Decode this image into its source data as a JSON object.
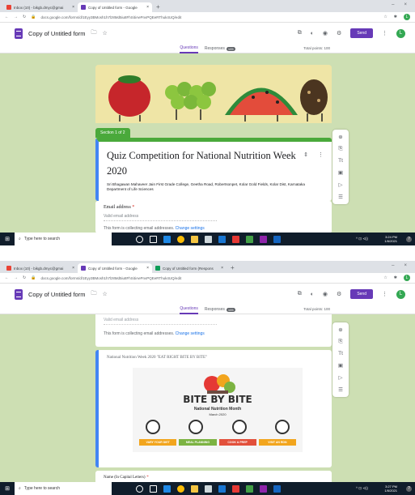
{
  "colors": {
    "accent": "#673ab7",
    "section": "#4aa93b",
    "canvas": "#cddfb3",
    "focus": "#4285f4"
  },
  "shot1": {
    "tabs": [
      {
        "label": "Inbox (10) - bikgb.dmyc@gmai",
        "fav": "#ea4335"
      },
      {
        "label": "Copy of Untitled form - Google",
        "fav": "#673ab7"
      }
    ],
    "url": "docs.google.com/forms/d/1Eyy3BMosh1h7lz8Md5iu8FhSitiAePnvPQEeRThuk4UQ/edit",
    "clock": {
      "time": "3:24 PM",
      "date": "1/6/2021"
    }
  },
  "shot2": {
    "tabs": [
      {
        "label": "Inbox (10) - bikgb.dmyc@gmai",
        "fav": "#ea4335"
      },
      {
        "label": "Copy of Untitled form - Google",
        "fav": "#673ab7"
      },
      {
        "label": "Copy of Untitled form (Respons",
        "fav": "#0f9d58"
      }
    ],
    "url": "docs.google.com/forms/d/1Eyy3BMosh1h7lz8Md5iu8FhSitiAePnvPQEeRThuk4UQ/edit",
    "clock": {
      "time": "3:27 PM",
      "date": "1/6/2021"
    }
  },
  "header": {
    "form_title": "Copy of Untitled form",
    "send_label": "Send",
    "avatar_letter": "L",
    "tab_questions": "Questions",
    "tab_responses": "Responses",
    "responses_count": "105",
    "total_points": "Total points: 100"
  },
  "form": {
    "section_label": "Section 1 of 2",
    "title": "Quiz Competition for National Nutrition Week 2020",
    "description_line1": "Sri Bhagawan  Mahaveer  Jain First Grade College, Geetha Road, Robertsonpet, Kolar Gold Fields, Kolar Dist, Karnataka",
    "description_line2": "Department of Life Sciences",
    "email_label": "Email address",
    "email_required": "*",
    "email_placeholder": "Valid email address",
    "collect_text": "This form is collecting email addresses.",
    "collect_link": "Change settings",
    "collect_text_cut": "This form is collecting email addresses.",
    "image_title": "National Nutrition Week 2020 \"EAT RIGHT BITE BY BITE\"",
    "name_label": "Name (In Capital Letters)",
    "name_required": "*"
  },
  "bite": {
    "logo": "BITE BY BITE",
    "sub": "National Nutrition Month",
    "sub2": "March 2020",
    "pills": [
      {
        "label": "VARY YOUR DIET",
        "color": "#f2a51d"
      },
      {
        "label": "MEAL PLANNING",
        "color": "#7cb342"
      },
      {
        "label": "COOK & PREP",
        "color": "#e2503b"
      },
      {
        "label": "VISIT AN RDN",
        "color": "#f2a51d"
      }
    ]
  },
  "taskbar": {
    "search_placeholder": "Type here to search"
  },
  "win": {
    "minimize": "–",
    "close": "×",
    "tray": "^ ⊡ ⊲))"
  }
}
